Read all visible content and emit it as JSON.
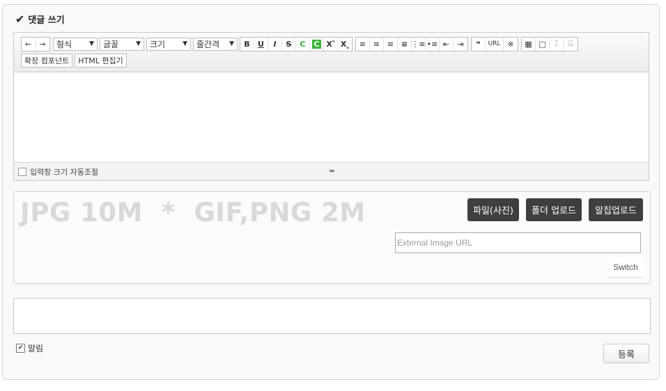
{
  "header": {
    "title": "댓글 쓰기",
    "check_icon": "checkmark-icon"
  },
  "toolbar": {
    "undo": "←",
    "redo": "→",
    "format_select": "형식",
    "font_select": "글꼴",
    "size_select": "크기",
    "line_spacing_select": "줄간격",
    "bold": "B",
    "underline": "U",
    "italic": "I",
    "strike": "S",
    "font_color": "C",
    "bg_color": "C",
    "superscript": "X",
    "superscript_mark": "ⁿ",
    "subscript": "X",
    "subscript_mark": "ₙ",
    "blockquote": "❝",
    "url": "URL",
    "special_char": "※",
    "extension_component": "확장 컴포넌트",
    "html_editor": "HTML 편집기"
  },
  "editor": {
    "autoresize_label": "입력창 크기 자동조절"
  },
  "upload": {
    "size_info": "JPG 10M  *  GIF,PNG 2M",
    "file_button": "파일(사진)",
    "folder_button": "폴더 업로드",
    "zip_button": "알집업로드",
    "external_url_placeholder": "External Image URL",
    "switch_button": "Switch"
  },
  "footer": {
    "notify_label": "알림",
    "notify_checked": true,
    "submit_button": "등록"
  }
}
